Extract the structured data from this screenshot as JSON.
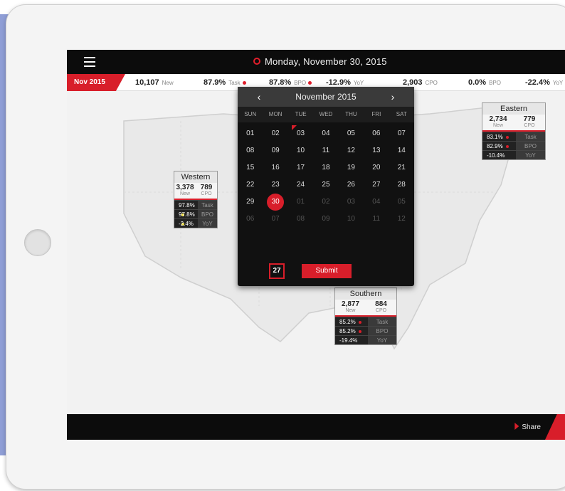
{
  "topbar": {
    "date": "Monday, November 30, 2015"
  },
  "stats": {
    "month": "Nov 2015",
    "items": [
      {
        "value": "10,107",
        "label": "New"
      },
      {
        "value": "87.9%",
        "label": "Task"
      },
      {
        "value": "87.8%",
        "label": "BPO"
      },
      {
        "value": "-12.9%",
        "label": "YoY"
      },
      {
        "value": "2,903",
        "label": "CPO"
      },
      {
        "value": "0.0%",
        "label": "BPO"
      },
      {
        "value": "-22.4%",
        "label": "YoY"
      }
    ]
  },
  "regions": {
    "western": {
      "name": "Western",
      "new": "3,378",
      "new_label": "New",
      "cpo": "789",
      "cpo_label": "CPO",
      "rows": [
        {
          "v": "97.8%",
          "k": "Task"
        },
        {
          "v": "97.8%",
          "k": "BPO"
        },
        {
          "v": "-2.4%",
          "k": "YoY"
        }
      ]
    },
    "eastern": {
      "name": "Eastern",
      "new": "2,734",
      "new_label": "New",
      "cpo": "779",
      "cpo_label": "CPO",
      "rows": [
        {
          "v": "83.1%",
          "k": "Task"
        },
        {
          "v": "82.9%",
          "k": "BPO"
        },
        {
          "v": "-10.4%",
          "k": "YoY"
        }
      ]
    },
    "southern": {
      "name": "Southern",
      "new": "2,877",
      "new_label": "New",
      "cpo": "884",
      "cpo_label": "CPO",
      "rows": [
        {
          "v": "85.2%",
          "k": "Task"
        },
        {
          "v": "85.2%",
          "k": "BPO"
        },
        {
          "v": "-19.4%",
          "k": "YoY"
        }
      ]
    }
  },
  "calendar": {
    "title": "November 2015",
    "prev": "‹",
    "next": "›",
    "weekdays": [
      "SUN",
      "MON",
      "TUE",
      "WED",
      "THU",
      "FRI",
      "SAT"
    ],
    "days": [
      "01",
      "02",
      "03",
      "04",
      "05",
      "06",
      "07",
      "08",
      "09",
      "10",
      "11",
      "12",
      "13",
      "14",
      "15",
      "16",
      "17",
      "18",
      "19",
      "20",
      "21",
      "22",
      "23",
      "24",
      "25",
      "26",
      "27",
      "28",
      "29",
      "30",
      "01",
      "02",
      "03",
      "04",
      "05",
      "06",
      "07",
      "08",
      "09",
      "10",
      "11",
      "12"
    ],
    "icon_day": "27",
    "submit": "Submit"
  },
  "footer": {
    "share": "Share"
  },
  "colors": {
    "accent": "#d81e2a",
    "bar": "#0c0c0c"
  }
}
